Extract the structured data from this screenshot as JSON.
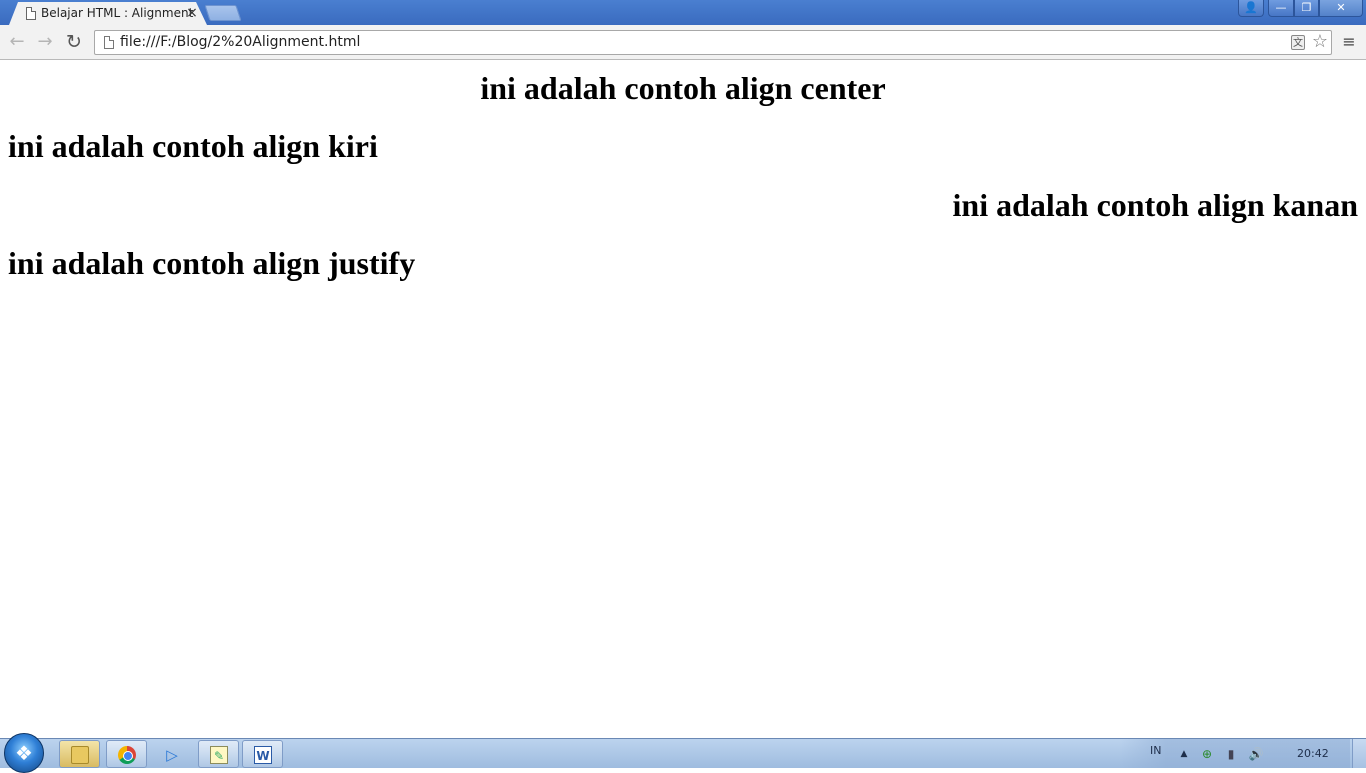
{
  "browser": {
    "tab": {
      "title": "Belajar HTML : Alignment",
      "close_glyph": "×",
      "icon": "document-icon"
    },
    "window_controls": {
      "user": "👤",
      "minimize": "—",
      "maximize": "❐",
      "close": "✕"
    },
    "toolbar": {
      "back_glyph": "←",
      "forward_glyph": "→",
      "reload_glyph": "↻",
      "url": "file:///F:/Blog/2%20Alignment.html",
      "translate_glyph": "文",
      "star_glyph": "☆",
      "menu_glyph": "≡"
    }
  },
  "page": {
    "heading_center": "ini adalah contoh align center",
    "heading_left": "ini adalah contoh align kiri",
    "heading_right": "ini adalah contoh align kanan",
    "heading_justify": "ini adalah contoh align justify"
  },
  "taskbar": {
    "pinned": [
      {
        "name": "explorer",
        "icon": "folder-icon"
      },
      {
        "name": "chrome",
        "icon": "chrome-icon"
      },
      {
        "name": "media-player",
        "icon": "play-icon",
        "glyph": "▷"
      },
      {
        "name": "sticky-notes",
        "icon": "notes-icon",
        "glyph": "✎"
      },
      {
        "name": "word",
        "icon": "word-icon",
        "glyph": "W"
      }
    ],
    "tray": {
      "language": "IN",
      "chevron_glyph": "▲",
      "globe_glyph": "⊕",
      "signal_glyph": "▮",
      "speaker_glyph": "🔊",
      "time": "20:42"
    }
  }
}
